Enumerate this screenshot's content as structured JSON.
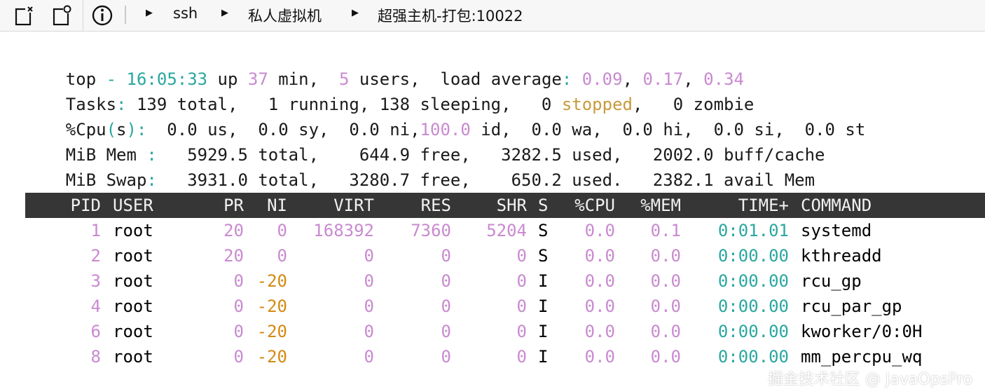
{
  "toolbar": {
    "breadcrumb": [
      "ssh",
      "私人虚拟机",
      "超强主机-打包:10022"
    ]
  },
  "summary": {
    "line1": {
      "prefix": "top",
      "dash": " - ",
      "time": "16:05:33",
      "up_label": " up ",
      "up_value": "37",
      "min_label": " min,  ",
      "users_value": "5",
      "users_label": " users,  load average",
      "colon": ":",
      "la1": "0.09",
      "comma1": ", ",
      "la2": "0.17",
      "comma2": ", ",
      "la3": "0.34"
    },
    "line2": {
      "label": "Tasks",
      "colon": ":",
      "total": " 139 total,   1 running, 138 sleeping,   0 ",
      "stopped": "stopped",
      "rest": ",   0 zombie"
    },
    "line3": {
      "label": "%Cpu",
      "paren_open": "(",
      "s": "s",
      "paren_close": ")",
      "colon": ":",
      "body": "  0.0 us,  0.0 sy,  0.0 ni,",
      "idle": "100.0",
      "rest": " id,  0.0 wa,  0.0 hi,  0.0 si,  0.0 st"
    },
    "line4": {
      "label": "MiB Mem ",
      "colon": ":",
      "body": "   5929.5 total,    644.9 free,   3282.5 used,   2002.0 buff/cache"
    },
    "line5": {
      "label": "MiB Swap",
      "colon": ":",
      "body": "   3931.0 total,   3280.7 free,    650.2 used.   2382.1 avail Mem"
    }
  },
  "table": {
    "headers": [
      "PID",
      "USER",
      "PR",
      "NI",
      "VIRT",
      "RES",
      "SHR",
      "S",
      "%CPU",
      "%MEM",
      "TIME+",
      "COMMAND"
    ],
    "rows": [
      {
        "pid": "1",
        "user": "root",
        "pr": "20",
        "ni": "0",
        "virt": "168392",
        "res": "7360",
        "shr": "5204",
        "s": "S",
        "cpu": "0.0",
        "mem": "0.1",
        "time": "0:01.01",
        "cmd": "systemd"
      },
      {
        "pid": "2",
        "user": "root",
        "pr": "20",
        "ni": "0",
        "virt": "0",
        "res": "0",
        "shr": "0",
        "s": "S",
        "cpu": "0.0",
        "mem": "0.0",
        "time": "0:00.00",
        "cmd": "kthreadd"
      },
      {
        "pid": "3",
        "user": "root",
        "pr": "0",
        "ni": "-20",
        "virt": "0",
        "res": "0",
        "shr": "0",
        "s": "I",
        "cpu": "0.0",
        "mem": "0.0",
        "time": "0:00.00",
        "cmd": "rcu_gp"
      },
      {
        "pid": "4",
        "user": "root",
        "pr": "0",
        "ni": "-20",
        "virt": "0",
        "res": "0",
        "shr": "0",
        "s": "I",
        "cpu": "0.0",
        "mem": "0.0",
        "time": "0:00.00",
        "cmd": "rcu_par_gp"
      },
      {
        "pid": "6",
        "user": "root",
        "pr": "0",
        "ni": "-20",
        "virt": "0",
        "res": "0",
        "shr": "0",
        "s": "I",
        "cpu": "0.0",
        "mem": "0.0",
        "time": "0:00.00",
        "cmd": "kworker/0:0H"
      },
      {
        "pid": "8",
        "user": "root",
        "pr": "0",
        "ni": "-20",
        "virt": "0",
        "res": "0",
        "shr": "0",
        "s": "I",
        "cpu": "0.0",
        "mem": "0.0",
        "time": "0:00.00",
        "cmd": "mm_percpu_wq"
      }
    ]
  },
  "watermark": "掘金技术社区 @ JavaOpsPro",
  "colors": {
    "accent_cyan": "#2aa7a0",
    "accent_pink": "#c98ad0",
    "accent_orange": "#c79a3a",
    "header_bar": "#363636"
  },
  "icons": [
    "edit-close-icon",
    "new-tab-icon",
    "info-icon",
    "play-arrow-icon"
  ]
}
